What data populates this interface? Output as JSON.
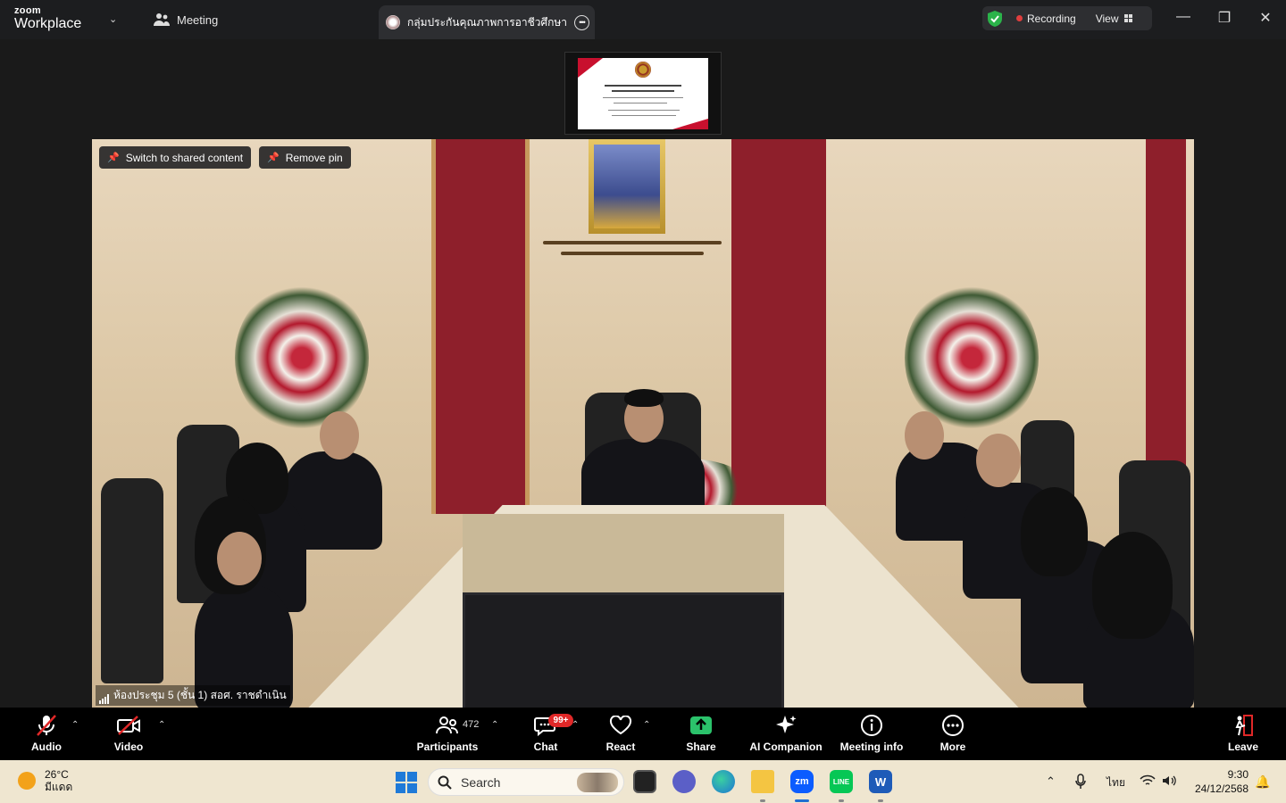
{
  "app": {
    "brand_top": "zoom",
    "brand_bottom": "Workplace"
  },
  "tabs": {
    "meeting_label": "Meeting",
    "active_title": "กลุ่มประกันคุณภาพการอาชีวศึกษา's sc"
  },
  "recording": {
    "label": "Recording",
    "view_label": "View"
  },
  "window_controls": [
    "—",
    "❐",
    "✕"
  ],
  "video": {
    "switch_label": "Switch to shared content",
    "remove_pin_label": "Remove pin",
    "participant_name": "ห้องประชุม 5 (ชั้น 1) สอศ. ราชดำเนิน"
  },
  "toolbar": {
    "audio": "Audio",
    "video": "Video",
    "participants": "Participants",
    "participants_count": "472",
    "chat": "Chat",
    "chat_badge": "99+",
    "react": "React",
    "share": "Share",
    "ai": "AI Companion",
    "info": "Meeting info",
    "more": "More",
    "leave": "Leave"
  },
  "taskbar": {
    "temperature": "26°C",
    "weather": "มีแดด",
    "search_placeholder": "Search",
    "language": "ไทย",
    "time": "9:30",
    "date": "24/12/2568",
    "zoom_app_label": "zm",
    "line_app_label": "LINE",
    "word_app_label": "W"
  },
  "colors": {
    "titlebar": "#1c1d1f",
    "toolbar": "#000000",
    "share_green": "#2bc26b",
    "badge_red": "#e02828",
    "taskbar": "#efe6d0",
    "accent_blue": "#1f6fd1"
  }
}
